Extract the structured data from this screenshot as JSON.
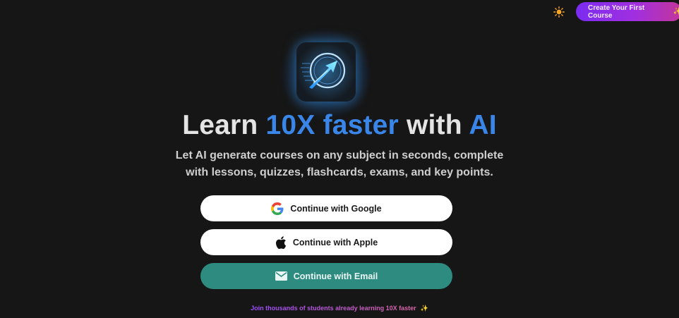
{
  "header": {
    "theme_toggle_icon": "sun-icon",
    "cta_label": "Create Your First Course",
    "cta_sparkle": "✨"
  },
  "hero": {
    "headline_part1": "Learn ",
    "headline_accent1": "10X faster",
    "headline_part2": " with ",
    "headline_accent2": "AI",
    "subtitle_line1": "Let AI generate courses on any subject in seconds, complete",
    "subtitle_line2": "with lessons, quizzes, flashcards, exams, and key points."
  },
  "auth": {
    "google_label": "Continue with Google",
    "apple_label": "Continue with Apple",
    "email_label": "Continue with Email"
  },
  "footer": {
    "note": "Join thousands of students already learning 10X faster",
    "sparkle": "✨"
  },
  "colors": {
    "background": "#161616",
    "accent_blue": "#3a86e8",
    "email_button": "#2e8b80",
    "cta_gradient_start": "#7b2cf0",
    "cta_gradient_end": "#c4359a"
  }
}
